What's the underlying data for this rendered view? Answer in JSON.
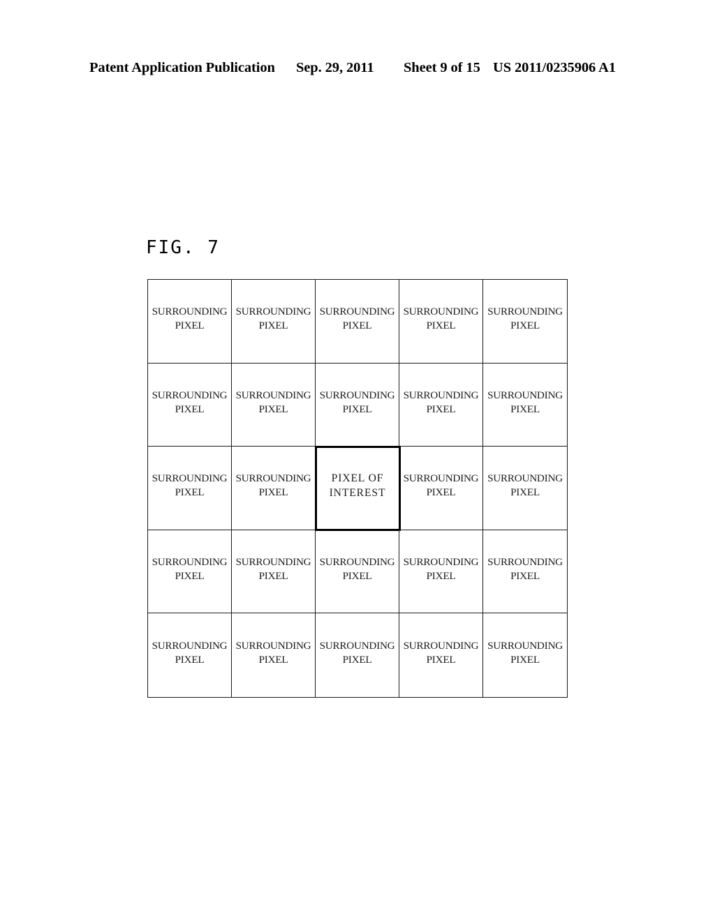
{
  "header": {
    "publication": "Patent Application Publication",
    "date": "Sep. 29, 2011",
    "sheet": "Sheet 9 of 15",
    "patent_number": "US 2011/0235906 A1"
  },
  "figure": {
    "label": "FIG. 7",
    "surrounding_label": "SURROUNDING\nPIXEL",
    "focus_label": "PIXEL OF\nINTEREST",
    "rows": 5,
    "columns": 5,
    "focus_row": 3,
    "focus_column": 3,
    "grid": [
      [
        "SURROUNDING\nPIXEL",
        "SURROUNDING\nPIXEL",
        "SURROUNDING\nPIXEL",
        "SURROUNDING\nPIXEL",
        "SURROUNDING\nPIXEL"
      ],
      [
        "SURROUNDING\nPIXEL",
        "SURROUNDING\nPIXEL",
        "SURROUNDING\nPIXEL",
        "SURROUNDING\nPIXEL",
        "SURROUNDING\nPIXEL"
      ],
      [
        "SURROUNDING\nPIXEL",
        "SURROUNDING\nPIXEL",
        "PIXEL OF\nINTEREST",
        "SURROUNDING\nPIXEL",
        "SURROUNDING\nPIXEL"
      ],
      [
        "SURROUNDING\nPIXEL",
        "SURROUNDING\nPIXEL",
        "SURROUNDING\nPIXEL",
        "SURROUNDING\nPIXEL",
        "SURROUNDING\nPIXEL"
      ],
      [
        "SURROUNDING\nPIXEL",
        "SURROUNDING\nPIXEL",
        "SURROUNDING\nPIXEL",
        "SURROUNDING\nPIXEL",
        "SURROUNDING\nPIXEL"
      ]
    ]
  },
  "colors": {
    "page_background": "#ffffff",
    "ink": "#000000",
    "grid_line": "#1a1a1a",
    "focus_border": "#000000"
  }
}
